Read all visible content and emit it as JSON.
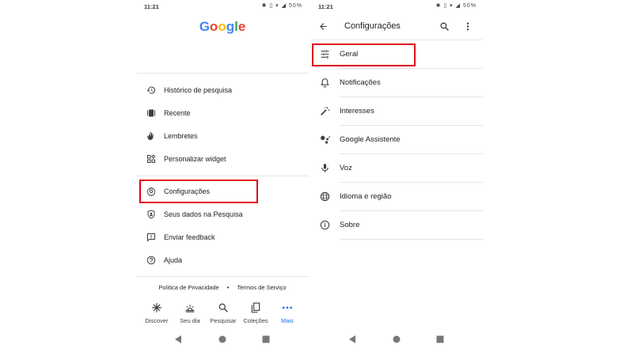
{
  "left_screen": {
    "status": {
      "time": "11:21",
      "battery": "50%"
    },
    "logo": "Google",
    "menu": [
      {
        "label": "Histórico de pesquisa",
        "icon": "history-icon"
      },
      {
        "label": "Recente",
        "icon": "recent-cards-icon"
      },
      {
        "label": "Lembretes",
        "icon": "reminder-hand-icon"
      },
      {
        "label": "Personalizar widget",
        "icon": "widget-icon"
      },
      {
        "label": "Configurações",
        "icon": "gear-icon"
      },
      {
        "label": "Seus dados na Pesquisa",
        "icon": "shield-icon"
      },
      {
        "label": "Enviar feedback",
        "icon": "feedback-icon"
      },
      {
        "label": "Ajuda",
        "icon": "help-icon"
      }
    ],
    "footer": {
      "privacy": "Política de Privacidade",
      "separator": "•",
      "terms": "Termos de Serviço"
    },
    "bottom_nav": [
      {
        "label": "Discover",
        "icon": "discover-icon"
      },
      {
        "label": "Seu dia",
        "icon": "sunrise-icon"
      },
      {
        "label": "Pesquisar",
        "icon": "search-icon"
      },
      {
        "label": "Coleções",
        "icon": "collections-icon"
      },
      {
        "label": "Mais",
        "icon": "more-dots-icon",
        "active": true
      }
    ],
    "highlight_target": "Configurações"
  },
  "right_screen": {
    "status": {
      "time": "11:21",
      "battery": "50%"
    },
    "title": "Configurações",
    "settings": [
      {
        "label": "Geral",
        "icon": "sliders-icon"
      },
      {
        "label": "Notificações",
        "icon": "bell-icon"
      },
      {
        "label": "Interesses",
        "icon": "magic-wand-icon"
      },
      {
        "label": "Google Assistente",
        "icon": "assistant-icon"
      },
      {
        "label": "Voz",
        "icon": "microphone-icon"
      },
      {
        "label": "Idioma e região",
        "icon": "globe-icon"
      },
      {
        "label": "Sobre",
        "icon": "info-icon"
      }
    ],
    "highlight_target": "Geral"
  },
  "colors": {
    "highlight": "#e0001a",
    "active_nav": "#1a73e8",
    "text": "#202124"
  }
}
